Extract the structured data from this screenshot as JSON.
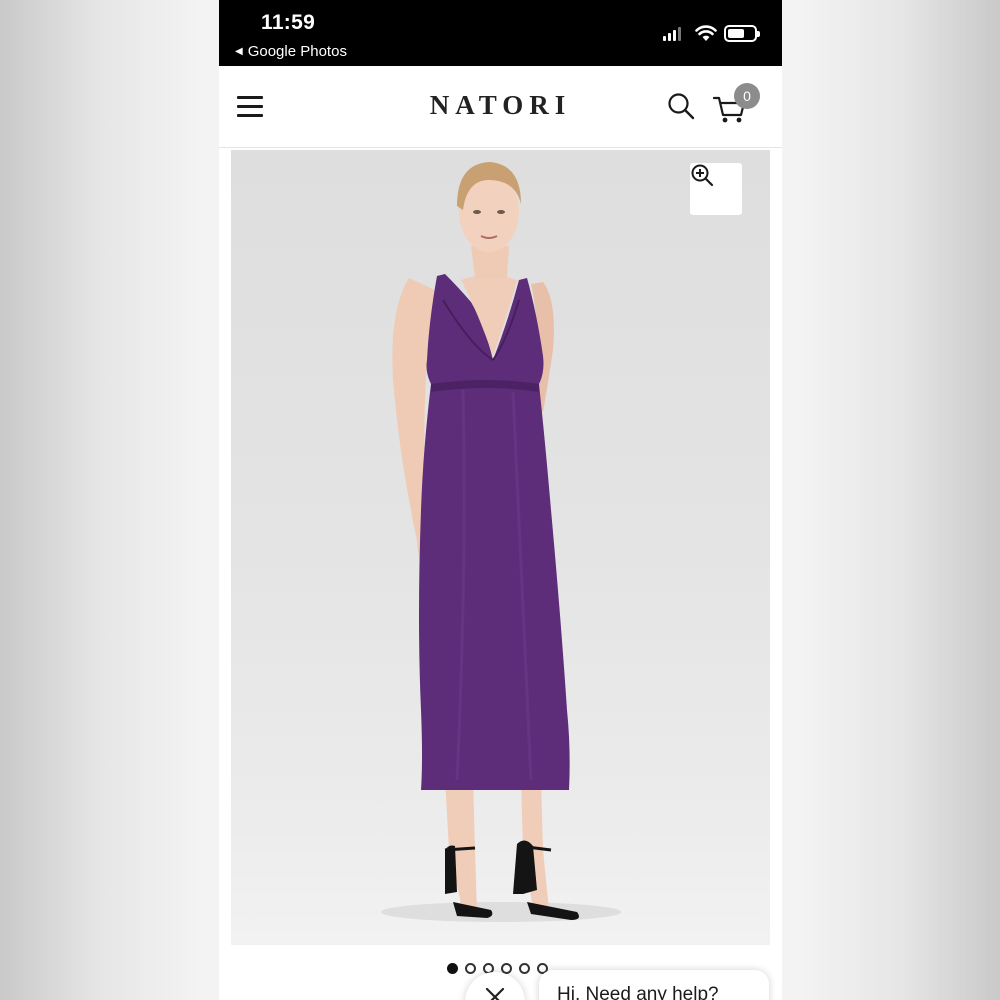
{
  "status_bar": {
    "time": "11:59",
    "back_app": "Google Photos"
  },
  "header": {
    "brand": "NATORI",
    "cart_count": "0"
  },
  "icons": {
    "menu": "hamburger-icon",
    "search": "search-icon",
    "cart": "cart-icon",
    "zoom": "zoom-in-icon",
    "close": "close-icon"
  },
  "product": {
    "dress_color": "#5e2d7a",
    "carousel": {
      "total": 6,
      "active": 1
    }
  },
  "chat": {
    "prompt": "Hi. Need any help?"
  }
}
